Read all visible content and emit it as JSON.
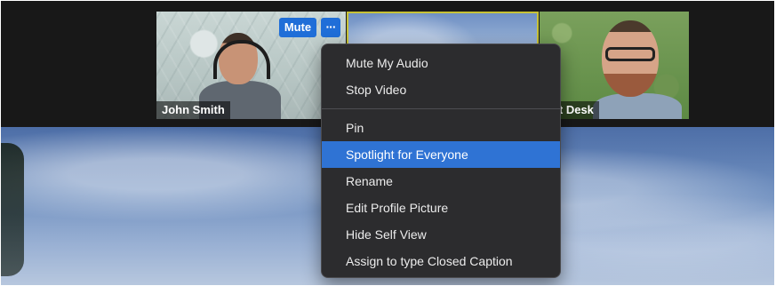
{
  "gallery": {
    "tiles": [
      {
        "name": "John Smith"
      },
      {
        "name": ""
      },
      {
        "name": "ont Desk"
      }
    ],
    "mute_button_label": "Mute",
    "more_button_glyph": "···"
  },
  "context_menu": {
    "group1": [
      {
        "label": "Mute My Audio"
      },
      {
        "label": "Stop Video"
      }
    ],
    "group2": [
      {
        "label": "Pin"
      },
      {
        "label": "Spotlight for Everyone",
        "selected": true
      },
      {
        "label": "Rename"
      },
      {
        "label": "Edit Profile Picture"
      },
      {
        "label": "Hide Self View"
      },
      {
        "label": "Assign to type Closed Caption"
      }
    ]
  },
  "colors": {
    "accent": "#2f73d4",
    "button_blue": "#1f6ed8",
    "menu_bg": "#2c2c2e",
    "active_speaker_border": "#c7c236"
  },
  "icons": {
    "more": "ellipsis-icon"
  }
}
